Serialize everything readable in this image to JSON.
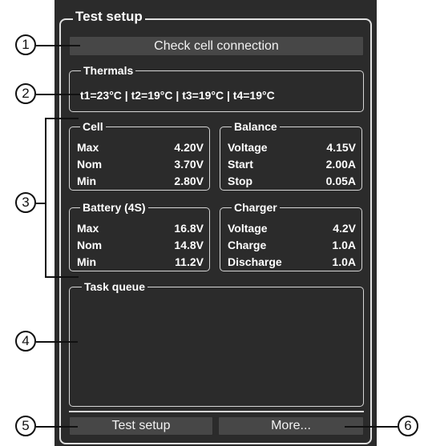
{
  "panel": {
    "title": "Test setup"
  },
  "check_button": {
    "label": "Check cell connection"
  },
  "thermals": {
    "title": "Thermals",
    "readout": "t1=23°C | t2=19°C | t3=19°C | t4=19°C"
  },
  "cell": {
    "title": "Cell",
    "rows": [
      {
        "label": "Max",
        "value": "4.20V"
      },
      {
        "label": "Nom",
        "value": "3.70V"
      },
      {
        "label": "Min",
        "value": "2.80V"
      }
    ]
  },
  "balance": {
    "title": "Balance",
    "rows": [
      {
        "label": "Voltage",
        "value": "4.15V"
      },
      {
        "label": "Start",
        "value": "2.00A"
      },
      {
        "label": "Stop",
        "value": "0.05A"
      }
    ]
  },
  "battery": {
    "title": "Battery (4S)",
    "rows": [
      {
        "label": "Max",
        "value": "16.8V"
      },
      {
        "label": "Nom",
        "value": "14.8V"
      },
      {
        "label": "Min",
        "value": "11.2V"
      }
    ]
  },
  "charger": {
    "title": "Charger",
    "rows": [
      {
        "label": "Voltage",
        "value": "4.2V"
      },
      {
        "label": "Charge",
        "value": "1.0A"
      },
      {
        "label": "Discharge",
        "value": "1.0A"
      }
    ]
  },
  "task_queue": {
    "title": "Task queue"
  },
  "footer": {
    "test_setup_label": "Test setup",
    "more_label": "More..."
  },
  "callouts": [
    "1",
    "2",
    "3",
    "4",
    "5",
    "6"
  ]
}
